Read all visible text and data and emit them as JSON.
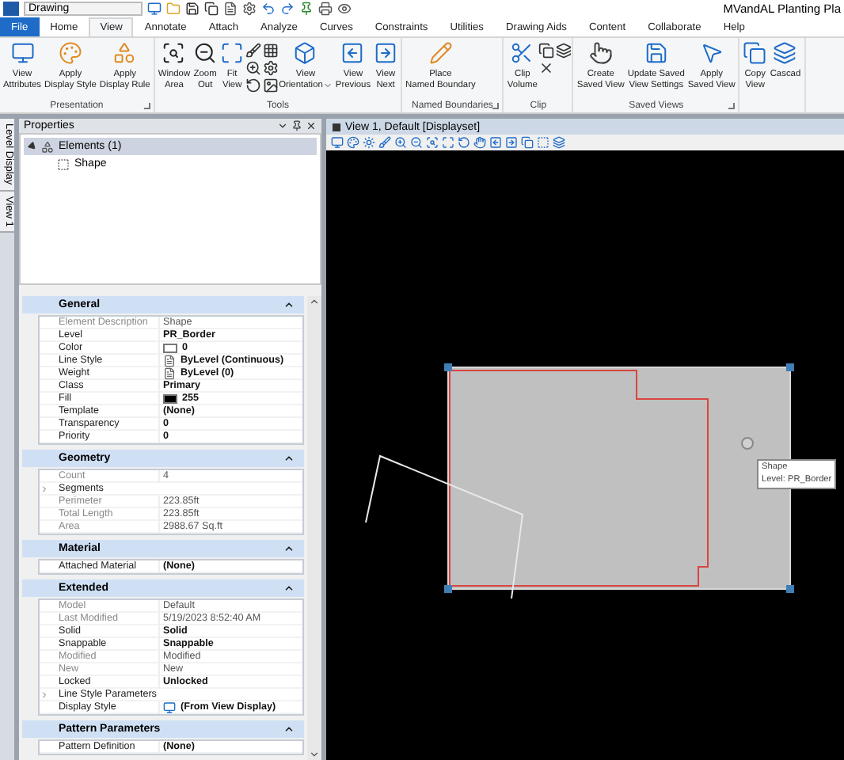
{
  "app": {
    "document": "Drawing",
    "title": "MVandAL Planting Pla"
  },
  "tabs": [
    {
      "label": "File",
      "kind": "file",
      "selected": false
    },
    {
      "label": "Home",
      "kind": "tab",
      "selected": false
    },
    {
      "label": "View",
      "kind": "tab",
      "selected": true
    },
    {
      "label": "Annotate",
      "kind": "tab",
      "selected": false
    },
    {
      "label": "Attach",
      "kind": "tab",
      "selected": false
    },
    {
      "label": "Analyze",
      "kind": "tab",
      "selected": false
    },
    {
      "label": "Curves",
      "kind": "tab",
      "selected": false
    },
    {
      "label": "Constraints",
      "kind": "tab",
      "selected": false
    },
    {
      "label": "Utilities",
      "kind": "tab",
      "selected": false
    },
    {
      "label": "Drawing Aids",
      "kind": "tab",
      "selected": false
    },
    {
      "label": "Content",
      "kind": "tab",
      "selected": false
    },
    {
      "label": "Collaborate",
      "kind": "tab",
      "selected": false
    },
    {
      "label": "Help",
      "kind": "tab",
      "selected": false
    }
  ],
  "ribbon": {
    "groups": [
      {
        "label": "Presentation",
        "launcher": true,
        "items": [
          {
            "kind": "large",
            "lines": [
              "View",
              "Attributes"
            ]
          },
          {
            "kind": "large",
            "lines": [
              "Apply",
              "Display Style"
            ]
          },
          {
            "kind": "large",
            "lines": [
              "Apply",
              "Display Rule"
            ]
          }
        ]
      },
      {
        "label": "Tools",
        "launcher": false,
        "items": [
          {
            "kind": "large",
            "lines": [
              "Window",
              "Area"
            ]
          },
          {
            "kind": "large",
            "lines": [
              "Zoom",
              "Out"
            ]
          },
          {
            "kind": "large",
            "lines": [
              "Fit",
              "View"
            ]
          },
          {
            "kind": "stack"
          },
          {
            "kind": "large",
            "lines": [
              "View",
              "Orientation"
            ],
            "dropdown": true
          },
          {
            "kind": "large",
            "lines": [
              "View",
              "Previous"
            ]
          },
          {
            "kind": "large",
            "lines": [
              "View",
              "Next"
            ]
          }
        ]
      },
      {
        "label": "Named Boundaries",
        "launcher": true,
        "items": [
          {
            "kind": "large",
            "lines": [
              "Place",
              "Named Boundary"
            ]
          }
        ]
      },
      {
        "label": "Clip",
        "launcher": false,
        "items": [
          {
            "kind": "large",
            "lines": [
              "Clip",
              "Volume"
            ]
          },
          {
            "kind": "stack"
          }
        ]
      },
      {
        "label": "Saved Views",
        "launcher": true,
        "items": [
          {
            "kind": "large",
            "lines": [
              "Create",
              "Saved View"
            ]
          },
          {
            "kind": "large",
            "lines": [
              "Update Saved",
              "View Settings"
            ]
          },
          {
            "kind": "large",
            "lines": [
              "Apply",
              "Saved View"
            ]
          }
        ]
      },
      {
        "items": [
          {
            "kind": "large",
            "lines": [
              "Copy",
              "View"
            ]
          },
          {
            "kind": "large",
            "lines": [
              "Cascad"
            ]
          }
        ]
      }
    ]
  },
  "side_tabs": [
    "Level Display",
    "View 1"
  ],
  "properties": {
    "title": "Properties",
    "tree": [
      {
        "label": "Elements (1)",
        "expanded": true,
        "selected": true,
        "children": [
          {
            "label": "Shape",
            "selected": false
          }
        ]
      }
    ],
    "sections": [
      {
        "title": "General",
        "expanded": true,
        "rows": [
          {
            "label": "Element Description",
            "value": "Shape",
            "kind": "text",
            "readonly": true
          },
          {
            "label": "Level",
            "value": "PR_Border",
            "kind": "text",
            "readonly": false
          },
          {
            "label": "Color",
            "value": "0",
            "kind": "color",
            "color": "#ffffff",
            "readonly": false
          },
          {
            "label": "Line Style",
            "value": "ByLevel (Continuous)",
            "kind": "style",
            "readonly": false
          },
          {
            "label": "Weight",
            "value": "ByLevel (0)",
            "kind": "style",
            "readonly": false
          },
          {
            "label": "Class",
            "value": "Primary",
            "kind": "text",
            "readonly": false
          },
          {
            "label": "Fill",
            "value": "255",
            "kind": "color",
            "color": "#000000",
            "readonly": false
          },
          {
            "label": "Template",
            "value": "(None)",
            "kind": "text",
            "readonly": false
          },
          {
            "label": "Transparency",
            "value": "0",
            "kind": "text",
            "readonly": false
          },
          {
            "label": "Priority",
            "value": "0",
            "kind": "text",
            "readonly": false
          }
        ]
      },
      {
        "title": "Geometry",
        "expanded": true,
        "rows": [
          {
            "label": "Count",
            "value": "4",
            "kind": "text",
            "readonly": true
          },
          {
            "label": "Segments",
            "kind": "group",
            "readonly": false
          },
          {
            "label": "Perimeter",
            "value": "223.85ft",
            "kind": "text",
            "readonly": true
          },
          {
            "label": "Total Length",
            "value": "223.85ft",
            "kind": "text",
            "readonly": true
          },
          {
            "label": "Area",
            "value": "2988.67 Sq.ft",
            "kind": "text",
            "readonly": true
          }
        ]
      },
      {
        "title": "Material",
        "expanded": true,
        "rows": [
          {
            "label": "Attached Material",
            "value": "(None)",
            "kind": "text",
            "readonly": false
          }
        ]
      },
      {
        "title": "Extended",
        "expanded": true,
        "rows": [
          {
            "label": "Model",
            "value": "Default",
            "kind": "text",
            "readonly": true
          },
          {
            "label": "Last Modified",
            "value": "5/19/2023 8:52:40 AM",
            "kind": "text",
            "readonly": true
          },
          {
            "label": "Solid",
            "value": "Solid",
            "kind": "text",
            "readonly": false
          },
          {
            "label": "Snappable",
            "value": "Snappable",
            "kind": "text",
            "readonly": false
          },
          {
            "label": "Modified",
            "value": "Modified",
            "kind": "text",
            "readonly": true
          },
          {
            "label": "New",
            "value": "New",
            "kind": "text",
            "readonly": true
          },
          {
            "label": "Locked",
            "value": "Unlocked",
            "kind": "text",
            "readonly": false
          },
          {
            "label": "Line Style Parameters",
            "kind": "group",
            "readonly": false
          },
          {
            "label": "Display Style",
            "value": "(From View Display)",
            "kind": "display",
            "readonly": false
          }
        ]
      },
      {
        "title": "Pattern Parameters",
        "expanded": true,
        "rows": [
          {
            "label": "Pattern Definition",
            "value": "(None)",
            "kind": "text",
            "readonly": false
          }
        ]
      }
    ]
  },
  "view": {
    "title": "View 1, Default [Displayset]",
    "tooltip": [
      "Shape",
      "Level: PR_Border"
    ]
  }
}
